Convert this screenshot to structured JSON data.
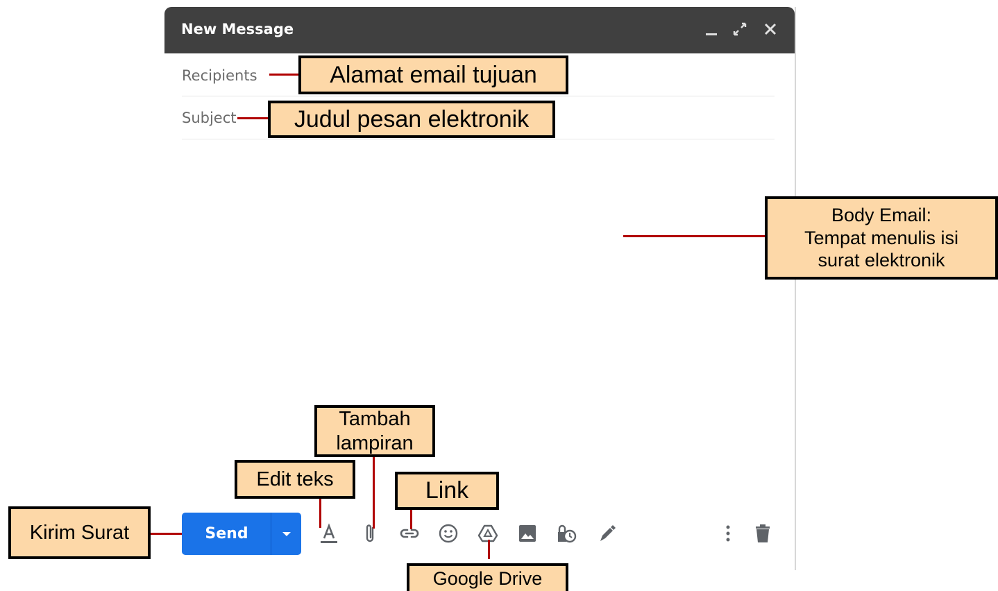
{
  "compose": {
    "title": "New Message",
    "header_icons": [
      "minimize-icon",
      "expand-icon",
      "close-icon"
    ],
    "recipients_placeholder": "Recipients",
    "subject_placeholder": "Subject",
    "send_label": "Send",
    "toolbar_icons": [
      "format-text-icon",
      "attach-file-icon",
      "insert-link-icon",
      "emoji-icon",
      "google-drive-icon",
      "insert-photo-icon",
      "confidential-mode-icon",
      "signature-icon",
      "more-options-icon",
      "discard-draft-icon"
    ],
    "colors": {
      "header_bg": "#404040",
      "send_blue": "#1a73e8",
      "icon_gray": "#5f6368"
    }
  },
  "annotations": {
    "recipients": "Alamat email tujuan",
    "subject": "Judul pesan elektronik",
    "body_line1": "Body Email:",
    "body_line2": "Tempat menulis isi",
    "body_line3": "surat elektronik",
    "attach_line1": "Tambah",
    "attach_line2": "lampiran",
    "edit_text": "Edit teks",
    "link": "Link",
    "send": "Kirim Surat",
    "drive": "Google Drive",
    "colors": {
      "callout_fill": "#fdd8a8",
      "leader_line": "#b00000"
    }
  }
}
